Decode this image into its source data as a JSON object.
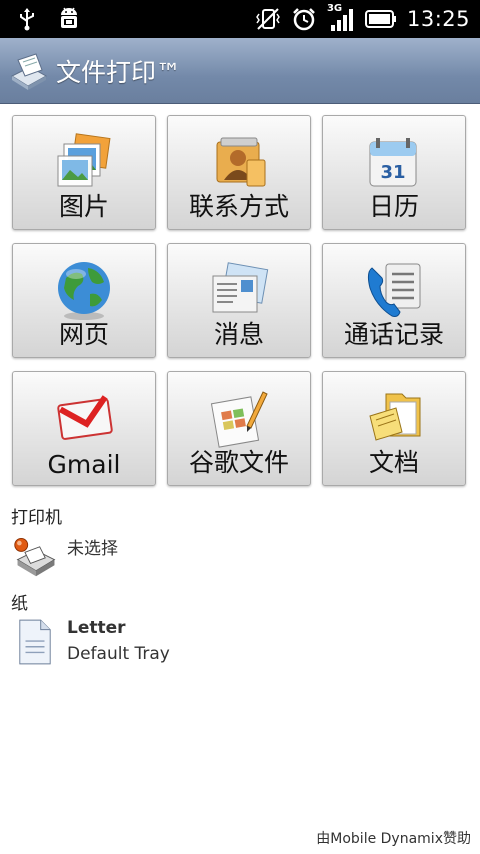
{
  "status_bar": {
    "time": "13:25",
    "left_icons": [
      "usb-icon",
      "android-debug-icon"
    ],
    "right_icons": [
      "vibrate-off-icon",
      "alarm-icon",
      "signal-3g-icon",
      "battery-icon"
    ],
    "network_label": "3G"
  },
  "app": {
    "title": "文件打印™",
    "icon": "printer-app-icon"
  },
  "tiles": [
    {
      "label": "图片",
      "icon": "pictures-icon"
    },
    {
      "label": "联系方式",
      "icon": "contacts-icon"
    },
    {
      "label": "日历",
      "icon": "calendar-icon",
      "calendar_day": "31"
    },
    {
      "label": "网页",
      "icon": "globe-icon"
    },
    {
      "label": "消息",
      "icon": "messages-icon"
    },
    {
      "label": "通话记录",
      "icon": "call-log-icon"
    },
    {
      "label": "Gmail",
      "icon": "gmail-icon"
    },
    {
      "label": "谷歌文件",
      "icon": "google-docs-icon"
    },
    {
      "label": "文档",
      "icon": "documents-folder-icon"
    }
  ],
  "printer": {
    "section_label": "打印机",
    "value": "未选择",
    "icon": "printer-icon"
  },
  "paper": {
    "section_label": "纸",
    "size": "Letter",
    "tray": "Default Tray",
    "icon": "paper-document-icon"
  },
  "footer": {
    "sponsor_text": "由Mobile Dynamix赞助"
  },
  "colors": {
    "title_bar": "#7a8fae",
    "status_bar": "#000000",
    "tile_bg": "#e6e6e6"
  }
}
